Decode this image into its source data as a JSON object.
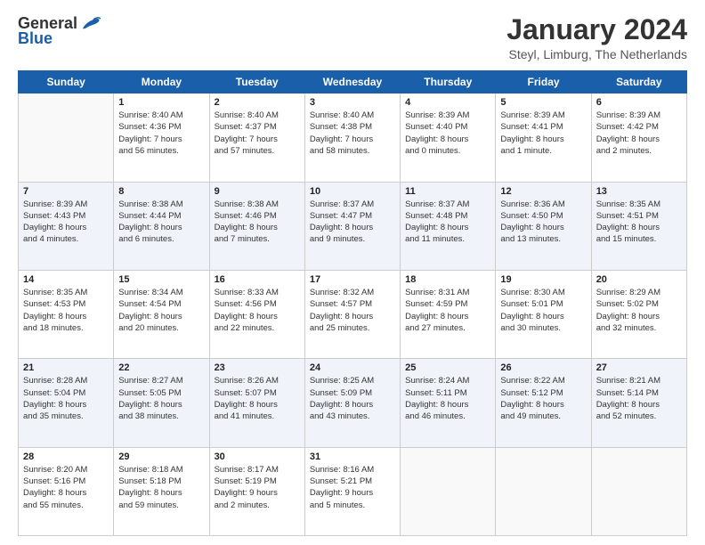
{
  "logo": {
    "general": "General",
    "blue": "Blue"
  },
  "title": "January 2024",
  "location": "Steyl, Limburg, The Netherlands",
  "days_of_week": [
    "Sunday",
    "Monday",
    "Tuesday",
    "Wednesday",
    "Thursday",
    "Friday",
    "Saturday"
  ],
  "weeks": [
    [
      {
        "num": "",
        "sunrise": "",
        "sunset": "",
        "daylight": ""
      },
      {
        "num": "1",
        "sunrise": "Sunrise: 8:40 AM",
        "sunset": "Sunset: 4:36 PM",
        "daylight": "Daylight: 7 hours and 56 minutes."
      },
      {
        "num": "2",
        "sunrise": "Sunrise: 8:40 AM",
        "sunset": "Sunset: 4:37 PM",
        "daylight": "Daylight: 7 hours and 57 minutes."
      },
      {
        "num": "3",
        "sunrise": "Sunrise: 8:40 AM",
        "sunset": "Sunset: 4:38 PM",
        "daylight": "Daylight: 7 hours and 58 minutes."
      },
      {
        "num": "4",
        "sunrise": "Sunrise: 8:39 AM",
        "sunset": "Sunset: 4:40 PM",
        "daylight": "Daylight: 8 hours and 0 minutes."
      },
      {
        "num": "5",
        "sunrise": "Sunrise: 8:39 AM",
        "sunset": "Sunset: 4:41 PM",
        "daylight": "Daylight: 8 hours and 1 minute."
      },
      {
        "num": "6",
        "sunrise": "Sunrise: 8:39 AM",
        "sunset": "Sunset: 4:42 PM",
        "daylight": "Daylight: 8 hours and 2 minutes."
      }
    ],
    [
      {
        "num": "7",
        "sunrise": "Sunrise: 8:39 AM",
        "sunset": "Sunset: 4:43 PM",
        "daylight": "Daylight: 8 hours and 4 minutes."
      },
      {
        "num": "8",
        "sunrise": "Sunrise: 8:38 AM",
        "sunset": "Sunset: 4:44 PM",
        "daylight": "Daylight: 8 hours and 6 minutes."
      },
      {
        "num": "9",
        "sunrise": "Sunrise: 8:38 AM",
        "sunset": "Sunset: 4:46 PM",
        "daylight": "Daylight: 8 hours and 7 minutes."
      },
      {
        "num": "10",
        "sunrise": "Sunrise: 8:37 AM",
        "sunset": "Sunset: 4:47 PM",
        "daylight": "Daylight: 8 hours and 9 minutes."
      },
      {
        "num": "11",
        "sunrise": "Sunrise: 8:37 AM",
        "sunset": "Sunset: 4:48 PM",
        "daylight": "Daylight: 8 hours and 11 minutes."
      },
      {
        "num": "12",
        "sunrise": "Sunrise: 8:36 AM",
        "sunset": "Sunset: 4:50 PM",
        "daylight": "Daylight: 8 hours and 13 minutes."
      },
      {
        "num": "13",
        "sunrise": "Sunrise: 8:35 AM",
        "sunset": "Sunset: 4:51 PM",
        "daylight": "Daylight: 8 hours and 15 minutes."
      }
    ],
    [
      {
        "num": "14",
        "sunrise": "Sunrise: 8:35 AM",
        "sunset": "Sunset: 4:53 PM",
        "daylight": "Daylight: 8 hours and 18 minutes."
      },
      {
        "num": "15",
        "sunrise": "Sunrise: 8:34 AM",
        "sunset": "Sunset: 4:54 PM",
        "daylight": "Daylight: 8 hours and 20 minutes."
      },
      {
        "num": "16",
        "sunrise": "Sunrise: 8:33 AM",
        "sunset": "Sunset: 4:56 PM",
        "daylight": "Daylight: 8 hours and 22 minutes."
      },
      {
        "num": "17",
        "sunrise": "Sunrise: 8:32 AM",
        "sunset": "Sunset: 4:57 PM",
        "daylight": "Daylight: 8 hours and 25 minutes."
      },
      {
        "num": "18",
        "sunrise": "Sunrise: 8:31 AM",
        "sunset": "Sunset: 4:59 PM",
        "daylight": "Daylight: 8 hours and 27 minutes."
      },
      {
        "num": "19",
        "sunrise": "Sunrise: 8:30 AM",
        "sunset": "Sunset: 5:01 PM",
        "daylight": "Daylight: 8 hours and 30 minutes."
      },
      {
        "num": "20",
        "sunrise": "Sunrise: 8:29 AM",
        "sunset": "Sunset: 5:02 PM",
        "daylight": "Daylight: 8 hours and 32 minutes."
      }
    ],
    [
      {
        "num": "21",
        "sunrise": "Sunrise: 8:28 AM",
        "sunset": "Sunset: 5:04 PM",
        "daylight": "Daylight: 8 hours and 35 minutes."
      },
      {
        "num": "22",
        "sunrise": "Sunrise: 8:27 AM",
        "sunset": "Sunset: 5:05 PM",
        "daylight": "Daylight: 8 hours and 38 minutes."
      },
      {
        "num": "23",
        "sunrise": "Sunrise: 8:26 AM",
        "sunset": "Sunset: 5:07 PM",
        "daylight": "Daylight: 8 hours and 41 minutes."
      },
      {
        "num": "24",
        "sunrise": "Sunrise: 8:25 AM",
        "sunset": "Sunset: 5:09 PM",
        "daylight": "Daylight: 8 hours and 43 minutes."
      },
      {
        "num": "25",
        "sunrise": "Sunrise: 8:24 AM",
        "sunset": "Sunset: 5:11 PM",
        "daylight": "Daylight: 8 hours and 46 minutes."
      },
      {
        "num": "26",
        "sunrise": "Sunrise: 8:22 AM",
        "sunset": "Sunset: 5:12 PM",
        "daylight": "Daylight: 8 hours and 49 minutes."
      },
      {
        "num": "27",
        "sunrise": "Sunrise: 8:21 AM",
        "sunset": "Sunset: 5:14 PM",
        "daylight": "Daylight: 8 hours and 52 minutes."
      }
    ],
    [
      {
        "num": "28",
        "sunrise": "Sunrise: 8:20 AM",
        "sunset": "Sunset: 5:16 PM",
        "daylight": "Daylight: 8 hours and 55 minutes."
      },
      {
        "num": "29",
        "sunrise": "Sunrise: 8:18 AM",
        "sunset": "Sunset: 5:18 PM",
        "daylight": "Daylight: 8 hours and 59 minutes."
      },
      {
        "num": "30",
        "sunrise": "Sunrise: 8:17 AM",
        "sunset": "Sunset: 5:19 PM",
        "daylight": "Daylight: 9 hours and 2 minutes."
      },
      {
        "num": "31",
        "sunrise": "Sunrise: 8:16 AM",
        "sunset": "Sunset: 5:21 PM",
        "daylight": "Daylight: 9 hours and 5 minutes."
      },
      {
        "num": "",
        "sunrise": "",
        "sunset": "",
        "daylight": ""
      },
      {
        "num": "",
        "sunrise": "",
        "sunset": "",
        "daylight": ""
      },
      {
        "num": "",
        "sunrise": "",
        "sunset": "",
        "daylight": ""
      }
    ]
  ]
}
